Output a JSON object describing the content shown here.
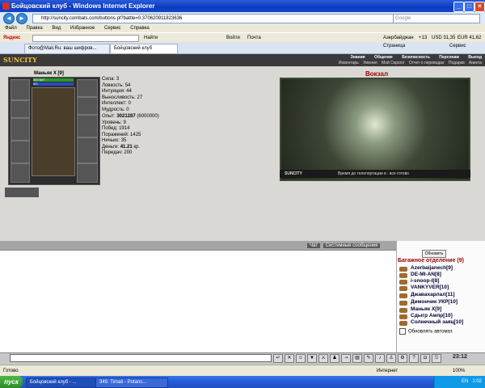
{
  "window": {
    "title": "Бойцовский клуб - Windows Internet Explorer"
  },
  "address": {
    "url": "http://suncity.combats.com/buttons.pl?battle=0.370620911823636",
    "search_placeholder": "Google"
  },
  "menu": [
    "Файл",
    "Правка",
    "Вид",
    "Избранное",
    "Сервис",
    "Справка"
  ],
  "yandex": {
    "label": "Яндекс",
    "find": "Найти",
    "login": "Войти",
    "mail": "Почта",
    "region": "Азербайджан",
    "temp": "+13",
    "usd": "USD 31,35",
    "eur": "EUR 41,62"
  },
  "tabs": [
    "Фото@Mail.Ru: ваш шифров...",
    "Бойцовский клуб"
  ],
  "ie": {
    "page": "Страница",
    "tools": "Сервис"
  },
  "game": {
    "logo": "SUNCITY",
    "top_nav": [
      "Знания",
      "Общение",
      "Безопасность",
      "Персонаж",
      "Выход"
    ],
    "sub_nav": [
      "Инвентарь",
      "Умения",
      "Мой Скролл",
      "Отчет о переводах",
      "Подарки",
      "Анкета"
    ],
    "character": {
      "name": "Маньяк Х [9]",
      "hp": "357/357",
      "mp": "0/0"
    },
    "stats": [
      {
        "label": "Сила:",
        "value": "3"
      },
      {
        "label": "Ловкость:",
        "value": "54"
      },
      {
        "label": "Интуиция:",
        "value": "44"
      },
      {
        "label": "Выносливость:",
        "value": "27"
      },
      {
        "label": "Интеллект:",
        "value": "0"
      },
      {
        "label": "Мудрость:",
        "value": "0"
      }
    ],
    "stats2": [
      {
        "label": "Опыт:",
        "value": "3021287",
        "extra": "(6000000)"
      },
      {
        "label": "Уровень:",
        "value": "9",
        "extra": ""
      },
      {
        "label": "Побед:",
        "value": "1914",
        "extra": ""
      },
      {
        "label": "Поражений:",
        "value": "1425",
        "extra": ""
      },
      {
        "label": "Ничьих:",
        "value": "35",
        "extra": ""
      },
      {
        "label": "Деньги:",
        "value": "41.21",
        "extra": "кр."
      },
      {
        "label": "Передач:",
        "value": "200",
        "extra": ""
      }
    ],
    "location": {
      "title": "Вокзал",
      "footer_logo": "SUNCITY",
      "footer_text": "Время до телепортации в : все готово"
    }
  },
  "chat": {
    "tabs": [
      "Чат",
      "Системные сообщения"
    ]
  },
  "sidebar": {
    "update_button": "Обновить",
    "location": "Багажное отделение (9)",
    "users": [
      "Azerbaijanech[9]",
      "DE-MI-AN[8]",
      "i-snoop-I[8]",
      "VANKYVER[10]",
      "Джавахарлал[11]",
      "Димончик УКР[10]",
      "Маньяк Х[9]",
      "Сдыгр Ампр[10]",
      "Солнечный заяц[10]"
    ],
    "auto_update": "Обновлять автомат."
  },
  "clock": "23:12",
  "status": {
    "left": "Готово",
    "zone": "Интернет",
    "zoom": "100%"
  },
  "taskbar": {
    "start": "пуск",
    "tasks": [
      "Бойцовский клуб - ...",
      "349. Timati - Potanc..."
    ],
    "lang": "EN",
    "time": "1:02"
  }
}
